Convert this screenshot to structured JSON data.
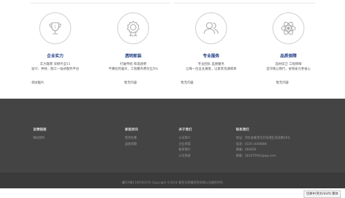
{
  "features": [
    {
      "title": "企业实力",
      "desc_lines": [
        "实力雄厚 深耕齐全11",
        "设计、供材、施工一站式服务平台"
      ],
      "more": "·测试图片",
      "icon": "trophy-icon",
      "accent": "#1c3c82"
    },
    {
      "title": "透明家装",
      "desc_lines": [
        "打破传统 和谐透明",
        "不赚任何差价，工程服务费仅五5%"
      ],
      "more": "暂无内容",
      "icon": "award-badge-icon",
      "accent": "#1c3c82"
    },
    {
      "title": "专业服务",
      "desc_lines": [
        "专业团队 品质服务",
        "让每一位业主满意，让家装充满简单"
      ],
      "more": "暂无内容",
      "icon": "users-icon",
      "accent": "#1c3c82"
    },
    {
      "title": "品质保障",
      "desc_lines": [
        "选材前卫 工程保障",
        "坚守随心我行，省钱省力更省心"
      ],
      "more": "暂无内容",
      "icon": "atom-icon",
      "accent": "#1c3c82"
    }
  ],
  "footer": {
    "columns": [
      {
        "title": "友情链接",
        "items": [
          "网站制作"
        ]
      },
      {
        "title": "家装资讯",
        "items": [
          "装饰优惠",
          "品质保障"
        ]
      },
      {
        "title": "关于我们",
        "items": [
          "公司简介",
          "企业荣誉",
          "联系我们",
          "公司资质"
        ]
      },
      {
        "title": "联系我们",
        "items": [
          "地址：河北省秦皇岛市海港区海滨路58号",
          "电话：0335-3048888",
          "邮编：066000",
          "邮箱：281875942@qq.com"
        ]
      }
    ],
    "copyright": "冀ICP备11007815号 Copyright ©2016 秦皇岛凯耀装饰有限公司版权所有"
  },
  "ime_indicator": "切换中/英文(Shift) 繁体",
  "colors": {
    "footer_bg": "#444444",
    "copy_bg": "#3b3b3b",
    "title_blue": "#1c3c82"
  }
}
